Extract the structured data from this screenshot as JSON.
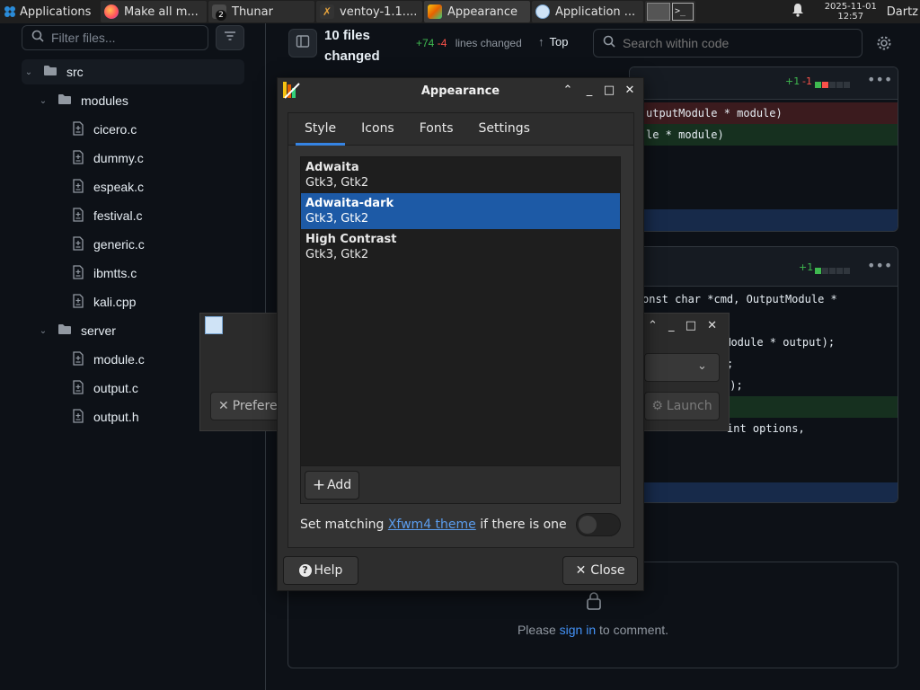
{
  "taskbar": {
    "applications": "Applications",
    "windows": [
      {
        "label": "Make all m...",
        "icon": "firefox-icon"
      },
      {
        "label": "Thunar",
        "icon": "file-manager-icon",
        "badge": "2"
      },
      {
        "label": "ventoy-1.1....",
        "icon": "ventoy-icon"
      },
      {
        "label": "Appearance",
        "icon": "appearance-icon"
      },
      {
        "label": "Application ...",
        "icon": "app-finder-icon"
      }
    ],
    "date": "2025-11-01",
    "time": "12:57",
    "user": "Dartz"
  },
  "sidebar": {
    "filter_placeholder": "Filter files...",
    "tree": [
      {
        "label": "src",
        "type": "folder",
        "level": 0
      },
      {
        "label": "modules",
        "type": "folder",
        "level": 1
      },
      {
        "label": "cicero.c",
        "type": "file",
        "level": 2
      },
      {
        "label": "dummy.c",
        "type": "file",
        "level": 2
      },
      {
        "label": "espeak.c",
        "type": "file",
        "level": 2
      },
      {
        "label": "festival.c",
        "type": "file",
        "level": 2
      },
      {
        "label": "generic.c",
        "type": "file",
        "level": 2
      },
      {
        "label": "ibmtts.c",
        "type": "file",
        "level": 2
      },
      {
        "label": "kali.cpp",
        "type": "file",
        "level": 2
      },
      {
        "label": "server",
        "type": "folder",
        "level": 1
      },
      {
        "label": "module.c",
        "type": "file",
        "level": 2
      },
      {
        "label": "output.c",
        "type": "file",
        "level": 2
      },
      {
        "label": "output.h",
        "type": "file",
        "level": 2
      }
    ]
  },
  "diff_header": {
    "files_changed": "10 files",
    "files_changed_2": "changed",
    "additions": "+74",
    "deletions": "-4",
    "lines_changed": "lines changed",
    "top": "Top",
    "search_placeholder": "Search within code"
  },
  "diff_panel_1": {
    "stat_add": "+1",
    "stat_del": "-1",
    "line_del": "utputModule * module)",
    "line_add": "le * module)"
  },
  "diff_panel_2": {
    "stat_add": "+1",
    "line_1": "onst char *cmd, OutputModule *",
    "line_2": "tModule * output);",
    "line_3": ";",
    "line_4": "t);",
    "line_5": "int options,"
  },
  "comment": {
    "prefix": "Please ",
    "link": "sign in",
    "suffix": " to comment."
  },
  "finder": {
    "preferences_label": "Prefere",
    "launch_label": "Launch"
  },
  "dialog": {
    "title": "Appearance",
    "tabs": [
      "Style",
      "Icons",
      "Fonts",
      "Settings"
    ],
    "themes": [
      {
        "name": "Adwaita",
        "sub": "Gtk3, Gtk2"
      },
      {
        "name": "Adwaita-dark",
        "sub": "Gtk3, Gtk2",
        "selected": true
      },
      {
        "name": "High Contrast",
        "sub": "Gtk3, Gtk2"
      }
    ],
    "add_label": "Add",
    "match_prefix": "Set matching ",
    "match_link": "Xfwm4 theme",
    "match_suffix": " if there is one",
    "help_label": "Help",
    "close_label": "Close"
  },
  "colors": {
    "accent": "#3584e4",
    "selection": "#1d5aa6",
    "additions": "#3fb950",
    "deletions": "#f85149"
  }
}
